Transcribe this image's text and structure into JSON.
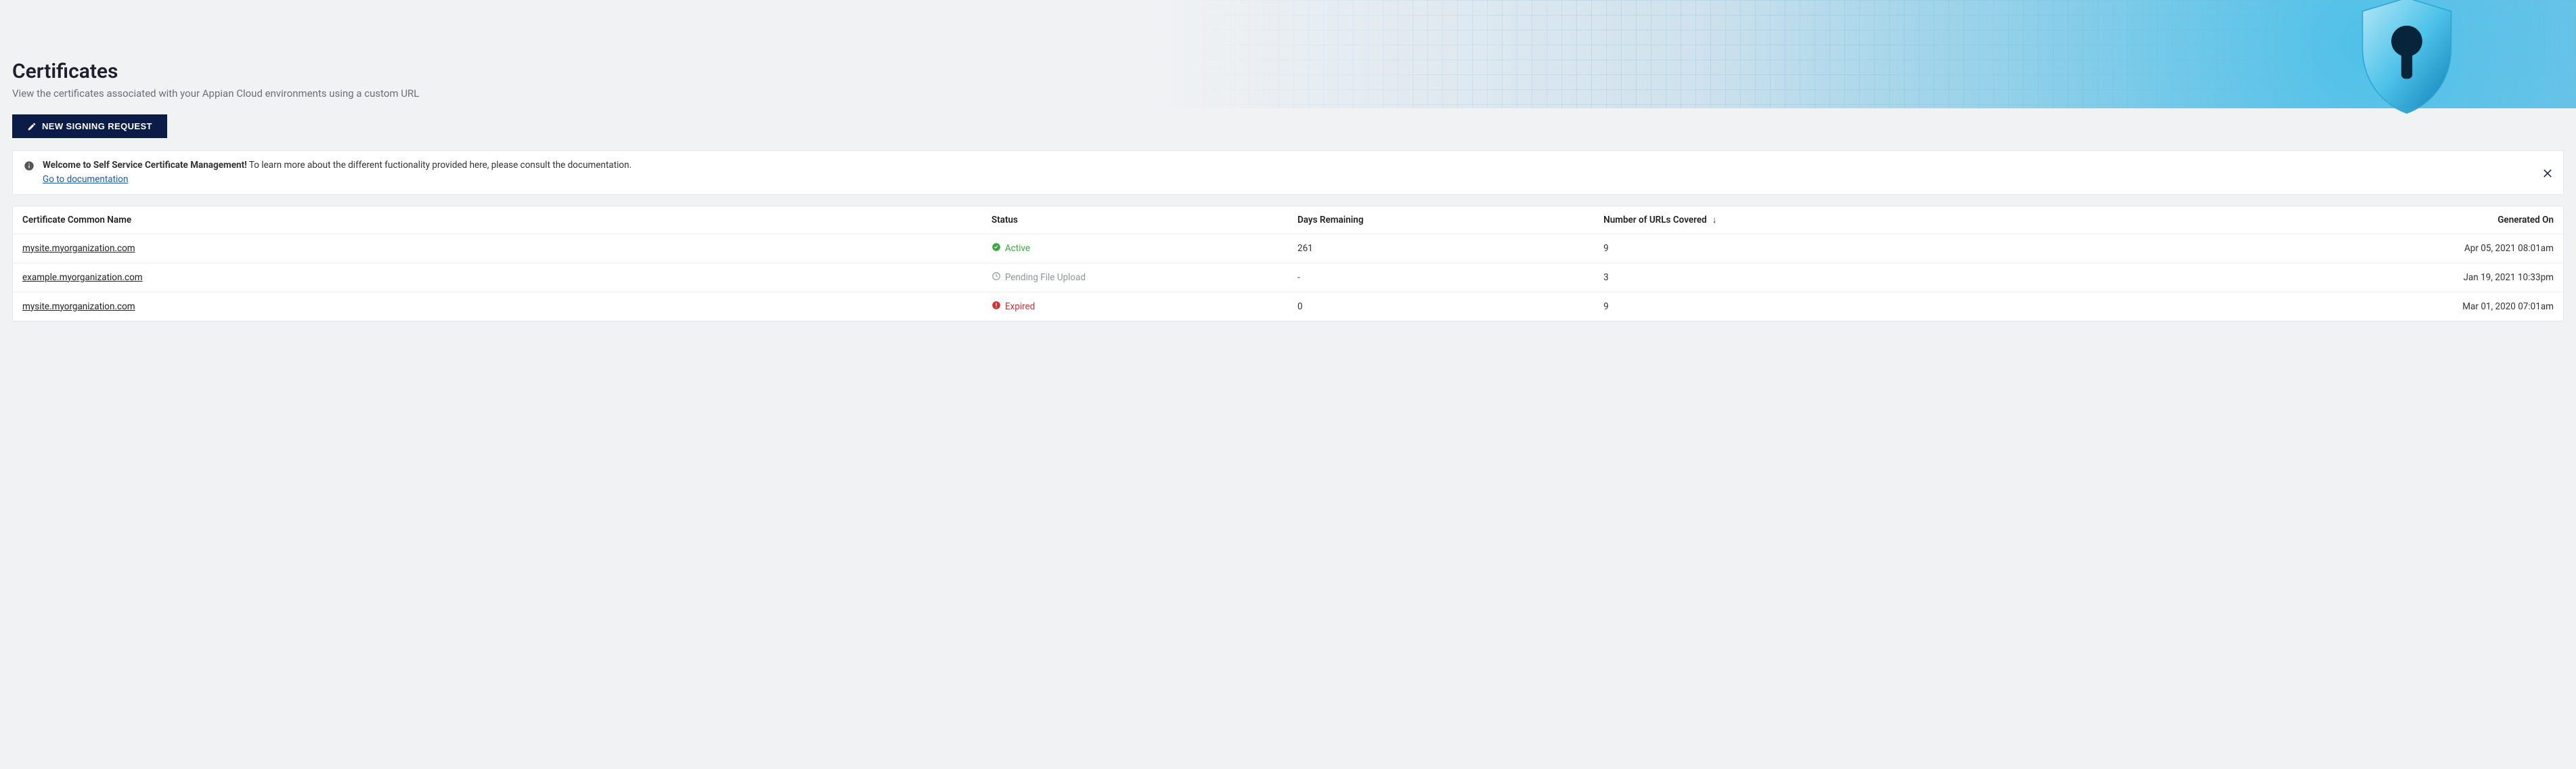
{
  "header": {
    "title": "Certificates",
    "subtitle": "View the certificates associated with your Appian Cloud environments using a custom URL",
    "new_request_label": "NEW SIGNING REQUEST"
  },
  "alert": {
    "bold": "Welcome to Self Service Certificate Management!",
    "text": " To learn more about the different fuctionality provided here, please consult the documentation.",
    "link_label": "Go to documentation"
  },
  "table": {
    "columns": {
      "name": "Certificate Common Name",
      "status": "Status",
      "days": "Days Remaining",
      "urls": "Number of URLs Covered",
      "generated": "Generated On"
    },
    "sort_indicator": "↓",
    "rows": [
      {
        "name": "mysite.myorganization.com",
        "status_kind": "active",
        "status_label": "Active",
        "days": "261",
        "urls": "9",
        "generated": "Apr 05, 2021 08:01am"
      },
      {
        "name": "example.myorganization.com",
        "status_kind": "pending",
        "status_label": "Pending File Upload",
        "days": "-",
        "urls": "3",
        "generated": "Jan 19, 2021 10:33pm"
      },
      {
        "name": "mysite.myorganization.com",
        "status_kind": "expired",
        "status_label": "Expired",
        "days": "0",
        "urls": "9",
        "generated": "Mar 01, 2020 07:01am"
      }
    ]
  },
  "colors": {
    "primary": "#0b1c49",
    "active": "#3fa63f",
    "pending": "#8f939a",
    "expired": "#c73434",
    "link": "#1a5a9e"
  }
}
